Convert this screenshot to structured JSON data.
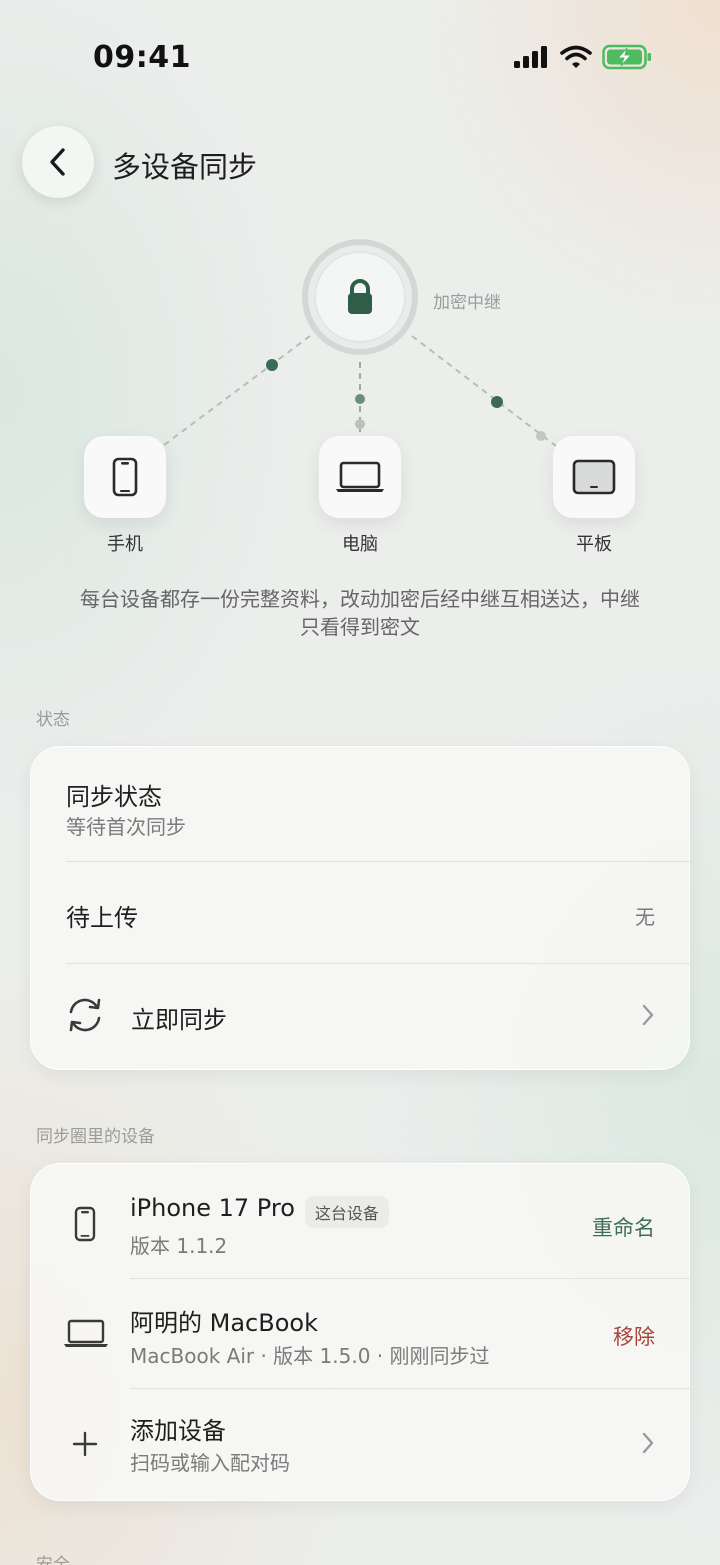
{
  "status_bar": {
    "time": "09:41"
  },
  "header": {
    "title": "多设备同步"
  },
  "diagram": {
    "hub_label": "加密中继",
    "devices": [
      {
        "label": "手机",
        "icon": "phone-icon"
      },
      {
        "label": "电脑",
        "icon": "laptop-icon"
      },
      {
        "label": "平板",
        "icon": "tablet-icon"
      }
    ],
    "description": "每台设备都存一份完整资料，改动加密后经中继互相送达，中继只看得到密文"
  },
  "status_section": {
    "label": "状态",
    "sync_status": {
      "title": "同步状态",
      "subtitle": "等待首次同步"
    },
    "pending_upload": {
      "title": "待上传",
      "value": "无"
    },
    "sync_now": {
      "title": "立即同步",
      "icon": "sync-icon"
    }
  },
  "devices_section": {
    "label": "同步圈里的设备",
    "items": [
      {
        "name": "iPhone 17 Pro",
        "badge": "这台设备",
        "detail": "版本 1.1.2",
        "action": "重命名",
        "icon": "phone-icon"
      },
      {
        "name": "阿明的 MacBook",
        "detail": "MacBook Air · 版本 1.5.0 · 刚刚同步过",
        "action": "移除",
        "icon": "laptop-icon"
      }
    ],
    "add_device": {
      "title": "添加设备",
      "subtitle": "扫码或输入配对码",
      "icon": "plus-icon"
    }
  },
  "next_section": {
    "label": "安全"
  },
  "colors": {
    "accent": "#3f6e59",
    "danger": "#a8453a",
    "lock": "#2f5d48"
  }
}
